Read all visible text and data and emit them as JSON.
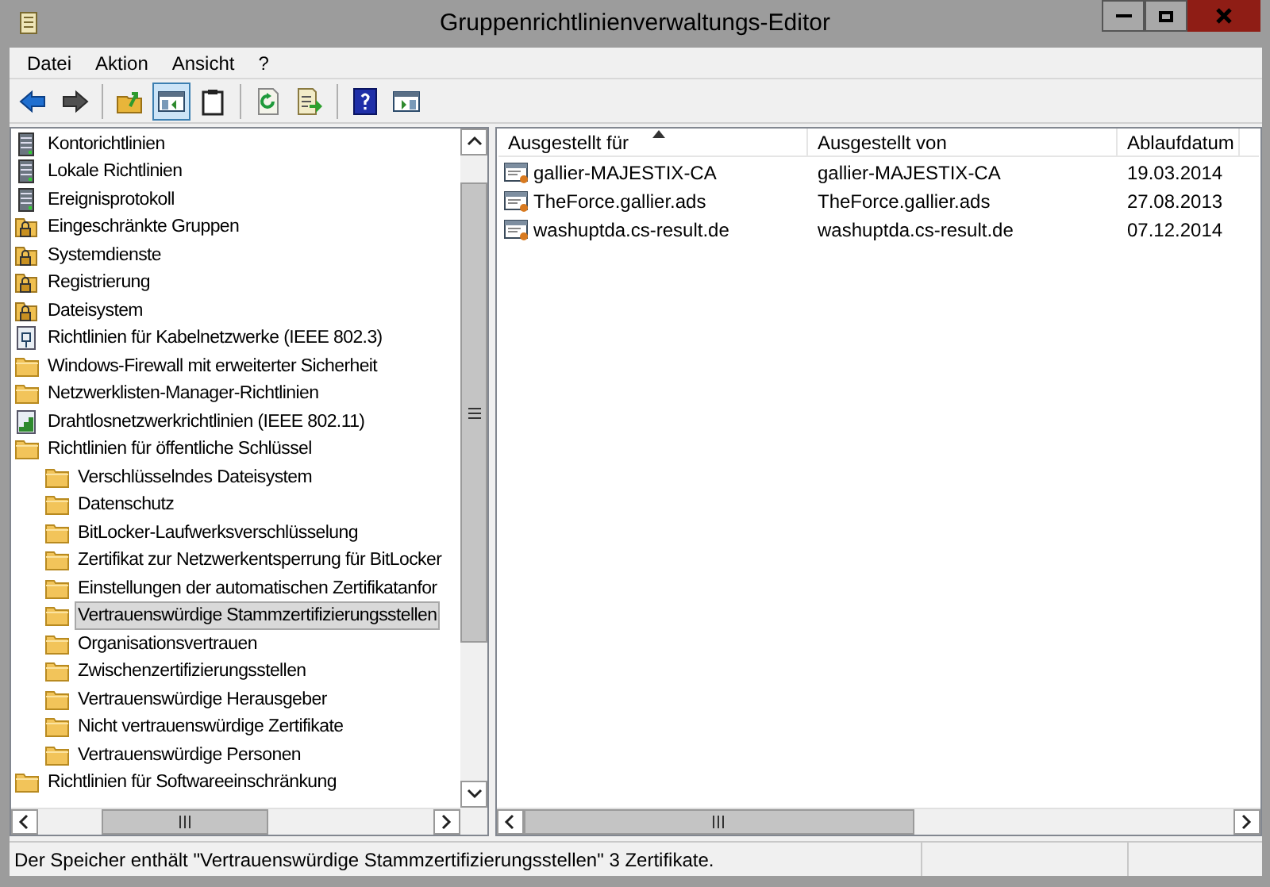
{
  "window": {
    "title": "Gruppenrichtlinienverwaltungs-Editor"
  },
  "menu": [
    {
      "label": "Datei"
    },
    {
      "label": "Aktion"
    },
    {
      "label": "Ansicht"
    },
    {
      "label": "?"
    }
  ],
  "toolbar": [
    [
      {
        "kind": "back",
        "selected": false
      },
      {
        "kind": "forward",
        "selected": false
      }
    ],
    [
      {
        "kind": "up",
        "selected": false
      },
      {
        "kind": "tree",
        "selected": true
      },
      {
        "kind": "clipboard",
        "selected": false
      }
    ],
    [
      {
        "kind": "refresh",
        "selected": false
      },
      {
        "kind": "export",
        "selected": false
      }
    ],
    [
      {
        "kind": "help",
        "selected": false
      },
      {
        "kind": "console",
        "selected": false
      }
    ]
  ],
  "tree": [
    {
      "label": "Kontorichtlinien",
      "kind": "policy",
      "selected": false
    },
    {
      "label": "Lokale Richtlinien",
      "kind": "policy",
      "selected": false
    },
    {
      "label": "Ereignisprotokoll",
      "kind": "policy",
      "selected": false
    },
    {
      "label": "Eingeschränkte Gruppen",
      "kind": "locked",
      "selected": false
    },
    {
      "label": "Systemdienste",
      "kind": "locked",
      "selected": false
    },
    {
      "label": "Registrierung",
      "kind": "locked",
      "selected": false
    },
    {
      "label": "Dateisystem",
      "kind": "locked",
      "selected": false
    },
    {
      "label": "Richtlinien für Kabelnetzwerke (IEEE 802.3)",
      "kind": "network",
      "selected": false
    },
    {
      "label": "Windows-Firewall mit erweiterter Sicherheit",
      "kind": "folder",
      "selected": false
    },
    {
      "label": "Netzwerklisten-Manager-Richtlinien",
      "kind": "folder",
      "selected": false
    },
    {
      "label": "Drahtlosnetzwerkrichtlinien (IEEE 802.11)",
      "kind": "wireless",
      "selected": false
    },
    {
      "label": "Richtlinien für öffentliche Schlüssel",
      "kind": "folder",
      "selected": false,
      "children": [
        {
          "label": "Verschlüsselndes Dateisystem",
          "kind": "folder",
          "selected": false
        },
        {
          "label": "Datenschutz",
          "kind": "folder",
          "selected": false
        },
        {
          "label": "BitLocker-Laufwerksverschlüsselung",
          "kind": "folder",
          "selected": false
        },
        {
          "label": "Zertifikat zur Netzwerkentsperrung für BitLocker",
          "kind": "folder",
          "selected": false
        },
        {
          "label": "Einstellungen der automatischen Zertifikatanfor",
          "kind": "folder",
          "selected": false
        },
        {
          "label": "Vertrauenswürdige Stammzertifizierungsstellen",
          "kind": "folder",
          "selected": true
        },
        {
          "label": "Organisationsvertrauen",
          "kind": "folder",
          "selected": false
        },
        {
          "label": "Zwischenzertifizierungsstellen",
          "kind": "folder",
          "selected": false
        },
        {
          "label": "Vertrauenswürdige Herausgeber",
          "kind": "folder",
          "selected": false
        },
        {
          "label": "Nicht vertrauenswürdige Zertifikate",
          "kind": "folder",
          "selected": false
        },
        {
          "label": "Vertrauenswürdige Personen",
          "kind": "folder",
          "selected": false
        }
      ]
    },
    {
      "label": "Richtlinien für Softwareeinschränkung",
      "kind": "folder",
      "selected": false
    }
  ],
  "table": {
    "columns": [
      {
        "label": "Ausgestellt für",
        "sorted": true
      },
      {
        "label": "Ausgestellt von",
        "sorted": false
      },
      {
        "label": "Ablaufdatum",
        "sorted": false
      }
    ],
    "rows": [
      [
        "gallier-MAJESTIX-CA",
        "gallier-MAJESTIX-CA",
        "19.03.2014"
      ],
      [
        "TheForce.gallier.ads",
        "TheForce.gallier.ads",
        "27.08.2013"
      ],
      [
        "washuptda.cs-result.de",
        "washuptda.cs-result.de",
        "07.12.2014"
      ]
    ]
  },
  "status_bar": {
    "text": "Der Speicher enthält \"Vertrauenswürdige Stammzertifizierungsstellen\" 3 Zertifikate."
  }
}
